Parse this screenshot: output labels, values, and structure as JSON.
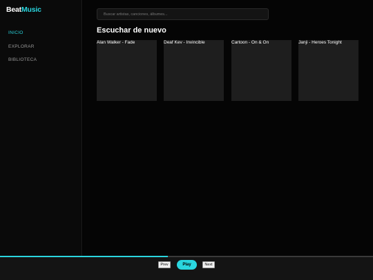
{
  "brand": {
    "part1": "Beat",
    "part2": "Music"
  },
  "colors": {
    "accent": "#2ad6df",
    "background": "#000000",
    "card": "#1e1e1e",
    "sidebar": "#0a0a0a"
  },
  "sidebar": {
    "items": [
      {
        "label": "INICIO",
        "active": true
      },
      {
        "label": "EXPLORAR",
        "active": false
      },
      {
        "label": "BIBLIOTECA",
        "active": false
      }
    ]
  },
  "search": {
    "placeholder": "Buscar artistas, canciones, álbumes...",
    "value": ""
  },
  "section": {
    "title": "Escuchar de nuevo"
  },
  "cards": [
    {
      "title": "Alan Walker - Fade"
    },
    {
      "title": "Deaf Kev - Invincible"
    },
    {
      "title": "Cartoon - On & On"
    },
    {
      "title": "Janji - Heroes Tonight"
    }
  ],
  "player": {
    "progress_fraction": 0.45,
    "prev_label": "Prev",
    "play_label": "Play",
    "next_label": "Next"
  }
}
